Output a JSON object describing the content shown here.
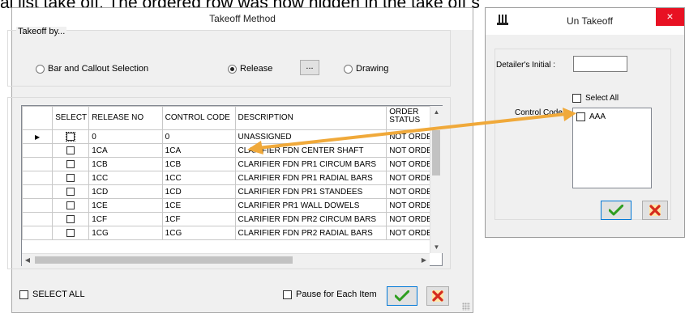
{
  "background": {
    "partial_text": "al list take off. The ordered row was now hidden in the take off s"
  },
  "takeoff_window": {
    "title": "Takeoff Method",
    "group_label": "Takeoff by...",
    "options": [
      {
        "label": "Bar and Callout Selection",
        "selected": false
      },
      {
        "label": "Release",
        "selected": true
      },
      {
        "label": "Drawing",
        "selected": false
      }
    ],
    "browse_label": "...",
    "grid": {
      "columns": [
        "SELECT",
        "RELEASE NO",
        "CONTROL CODE",
        "DESCRIPTION",
        "ORDER STATUS"
      ],
      "rows": [
        {
          "release": "0",
          "control": "0",
          "description": "UNASSIGNED",
          "status": "NOT ORDE",
          "current": true
        },
        {
          "release": "1CA",
          "control": "1CA",
          "description": "CLARIFIER FDN CENTER SHAFT",
          "status": "NOT ORDE"
        },
        {
          "release": "1CB",
          "control": "1CB",
          "description": "CLARIFIER FDN PR1 CIRCUM BARS",
          "status": "NOT ORDE"
        },
        {
          "release": "1CC",
          "control": "1CC",
          "description": "CLARIFIER FDN PR1 RADIAL BARS",
          "status": "NOT ORDE"
        },
        {
          "release": "1CD",
          "control": "1CD",
          "description": "CLARIFIER FDN PR1 STANDEES",
          "status": "NOT ORDE"
        },
        {
          "release": "1CE",
          "control": "1CE",
          "description": "CLARIFIER PR1 WALL DOWELS",
          "status": "NOT ORDE"
        },
        {
          "release": "1CF",
          "control": "1CF",
          "description": "CLARIFIER FDN PR2 CIRCUM BARS",
          "status": "NOT ORDE"
        },
        {
          "release": "1CG",
          "control": "1CG",
          "description": "CLARIFIER FDN PR2 RADIAL BARS",
          "status": "NOT ORDE"
        }
      ]
    },
    "select_all_label": "SELECT ALL",
    "pause_label": "Pause for Each Item"
  },
  "untakeoff_window": {
    "title": "Un Takeoff",
    "close_glyph": "×",
    "initial_label": "Detailer's Initial :",
    "initial_value": "",
    "select_all_label": "Select All",
    "control_code_label": "Control Code",
    "codes": [
      "AAA"
    ]
  },
  "colors": {
    "ok_check": "#2e9e1f",
    "cancel_x": "#d52b1e",
    "arrow": "#f0a93a",
    "close_button": "#e81123"
  }
}
